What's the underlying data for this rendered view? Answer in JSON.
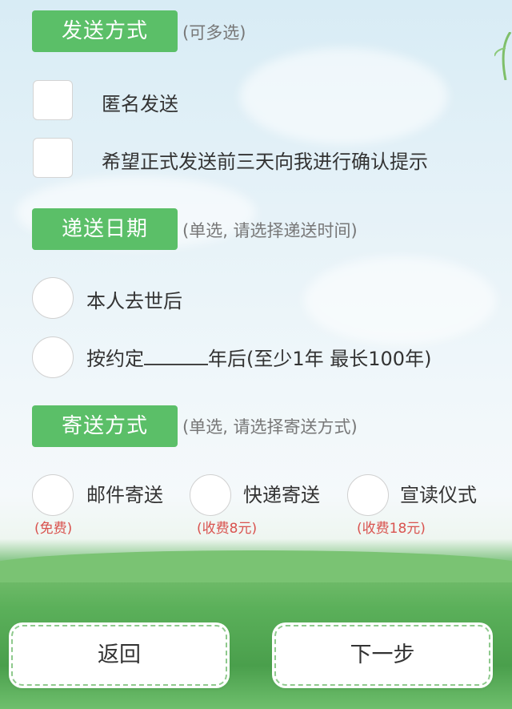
{
  "send_method": {
    "tag": "发送方式",
    "hint": "(可多选)",
    "options": [
      {
        "label": "匿名发送"
      },
      {
        "label": "希望正式发送前三天向我进行确认提示"
      }
    ]
  },
  "delivery_date": {
    "tag": "递送日期",
    "hint": "(单选, 请选择递送时间)",
    "options": [
      {
        "label": "本人去世后"
      },
      {
        "label_before": "按约定",
        "label_after": "年后(至少1年 最长100年)"
      }
    ]
  },
  "shipping_method": {
    "tag": "寄送方式",
    "hint": "(单选, 请选择寄送方式)",
    "options": [
      {
        "label": "邮件寄送",
        "fee": "(免费)"
      },
      {
        "label": "快递寄送",
        "fee": "(收费8元)"
      },
      {
        "label": "宣读仪式",
        "fee": "(收费18元)"
      }
    ]
  },
  "buttons": {
    "back": "返回",
    "next": "下一步"
  },
  "colors": {
    "tag_green": "#5bbf68",
    "fee_red": "#d9534f",
    "grass_green": "#5bb05a"
  }
}
